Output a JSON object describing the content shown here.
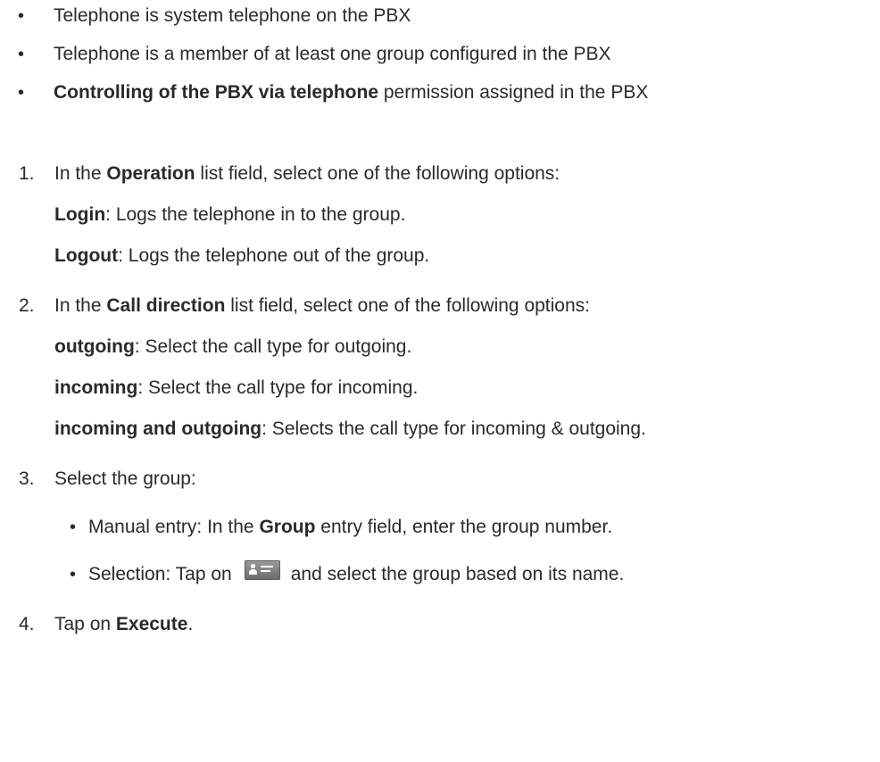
{
  "prerequisites": [
    {
      "pre": "",
      "bold": "",
      "post": "Telephone is system telephone on the PBX"
    },
    {
      "pre": "",
      "bold": "",
      "post": "Telephone is a member of at least one group configured in the PBX"
    },
    {
      "pre": "",
      "bold": "Controlling of the PBX via telephone",
      "post": " permission assigned in the PBX"
    }
  ],
  "steps": [
    {
      "number": "1.",
      "pre": "In the ",
      "bold": "Operation",
      "post": " list field, select one of the following options:",
      "options": [
        {
          "bold": "Login",
          "text": ": Logs the telephone in to the group."
        },
        {
          "bold": "Logout",
          "text": ": Logs the telephone out of the group."
        }
      ]
    },
    {
      "number": "2.",
      "pre": "In the ",
      "bold": "Call direction",
      "post": " list field, select one of the following options:",
      "options": [
        {
          "bold": "outgoing",
          "text": ": Select the call type for outgoing."
        },
        {
          "bold": "incoming",
          "text": ": Select the call type for incoming."
        },
        {
          "bold": "incoming and outgoing",
          "text": ": Selects the call type for incoming & outgoing."
        }
      ]
    },
    {
      "number": "3.",
      "text": "Select the group:",
      "sub_manual": {
        "pre": "Manual entry: In the ",
        "bold": "Group",
        "post": " entry field, enter the group number."
      },
      "sub_selection": {
        "pre": "Selection: Tap on",
        "post": "and select the group based on its name.",
        "icon": "directory-icon"
      }
    },
    {
      "number": "4.",
      "pre": "Tap on ",
      "bold": "Execute",
      "post": "."
    }
  ]
}
